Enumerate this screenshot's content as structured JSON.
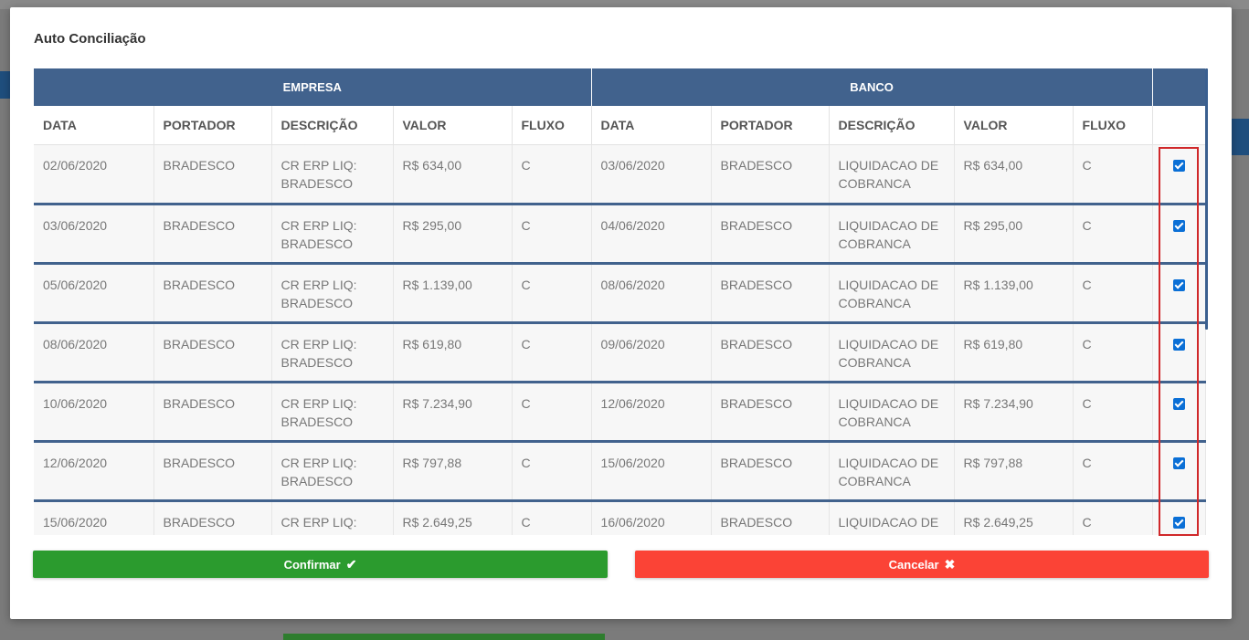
{
  "modal": {
    "title": "Auto Conciliação",
    "groups": {
      "empresa": "EMPRESA",
      "banco": "BANCO"
    },
    "columns": [
      "DATA",
      "PORTADOR",
      "DESCRIÇÃO",
      "VALOR",
      "FLUXO",
      "DATA",
      "PORTADOR",
      "DESCRIÇÃO",
      "VALOR",
      "FLUXO"
    ],
    "rows": [
      {
        "e_data": "02/06/2020",
        "e_portador": "BRADESCO",
        "e_desc": "CR ERP LIQ: BRADESCO",
        "e_valor": "R$ 634,00",
        "e_fluxo": "C",
        "b_data": "03/06/2020",
        "b_portador": "BRADESCO",
        "b_desc": "LIQUIDACAO DE COBRANCA",
        "b_valor": "R$ 634,00",
        "b_fluxo": "C",
        "checked": true
      },
      {
        "e_data": "03/06/2020",
        "e_portador": "BRADESCO",
        "e_desc": "CR ERP LIQ: BRADESCO",
        "e_valor": "R$ 295,00",
        "e_fluxo": "C",
        "b_data": "04/06/2020",
        "b_portador": "BRADESCO",
        "b_desc": "LIQUIDACAO DE COBRANCA",
        "b_valor": "R$ 295,00",
        "b_fluxo": "C",
        "checked": true
      },
      {
        "e_data": "05/06/2020",
        "e_portador": "BRADESCO",
        "e_desc": "CR ERP LIQ: BRADESCO",
        "e_valor": "R$ 1.139,00",
        "e_fluxo": "C",
        "b_data": "08/06/2020",
        "b_portador": "BRADESCO",
        "b_desc": "LIQUIDACAO DE COBRANCA",
        "b_valor": "R$ 1.139,00",
        "b_fluxo": "C",
        "checked": true
      },
      {
        "e_data": "08/06/2020",
        "e_portador": "BRADESCO",
        "e_desc": "CR ERP LIQ: BRADESCO",
        "e_valor": "R$ 619,80",
        "e_fluxo": "C",
        "b_data": "09/06/2020",
        "b_portador": "BRADESCO",
        "b_desc": "LIQUIDACAO DE COBRANCA",
        "b_valor": "R$ 619,80",
        "b_fluxo": "C",
        "checked": true
      },
      {
        "e_data": "10/06/2020",
        "e_portador": "BRADESCO",
        "e_desc": "CR ERP LIQ: BRADESCO",
        "e_valor": "R$ 7.234,90",
        "e_fluxo": "C",
        "b_data": "12/06/2020",
        "b_portador": "BRADESCO",
        "b_desc": "LIQUIDACAO DE COBRANCA",
        "b_valor": "R$ 7.234,90",
        "b_fluxo": "C",
        "checked": true
      },
      {
        "e_data": "12/06/2020",
        "e_portador": "BRADESCO",
        "e_desc": "CR ERP LIQ: BRADESCO",
        "e_valor": "R$ 797,88",
        "e_fluxo": "C",
        "b_data": "15/06/2020",
        "b_portador": "BRADESCO",
        "b_desc": "LIQUIDACAO DE COBRANCA",
        "b_valor": "R$ 797,88",
        "b_fluxo": "C",
        "checked": true
      },
      {
        "e_data": "15/06/2020",
        "e_portador": "BRADESCO",
        "e_desc": "CR ERP LIQ: BRADESCO",
        "e_valor": "R$ 2.649,25",
        "e_fluxo": "C",
        "b_data": "16/06/2020",
        "b_portador": "BRADESCO",
        "b_desc": "LIQUIDACAO DE COBRANCA",
        "b_valor": "R$ 2.649,25",
        "b_fluxo": "C",
        "checked": true
      }
    ],
    "buttons": {
      "confirm_label": "Confirmar",
      "confirm_icon": "check-icon",
      "cancel_label": "Cancelar",
      "cancel_icon": "x-icon"
    },
    "colors": {
      "header_blue": "#41628d",
      "confirm_green": "#2b9b2e",
      "cancel_red": "#fb4336",
      "highlight_red": "#d0282a",
      "checkbox_blue": "#0a6fd6"
    }
  }
}
